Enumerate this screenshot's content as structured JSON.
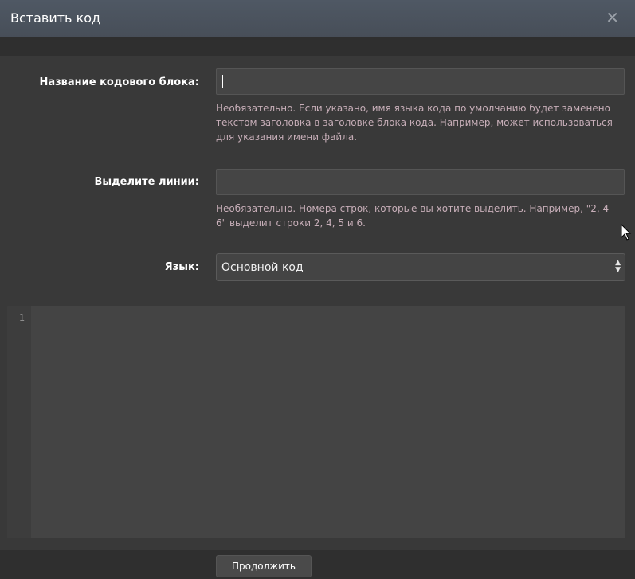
{
  "dialog": {
    "title": "Вставить код",
    "close_glyph": "✕"
  },
  "fields": {
    "block_name": {
      "label": "Название кодового блока:",
      "value": "",
      "hint": "Необязательно. Если указано, имя языка кода по умолчанию будет заменено текстом заголовка в заголовке блока кода. Например, может использоваться для указания имени файла."
    },
    "highlight_lines": {
      "label": "Выделите линии:",
      "value": "",
      "hint": "Необязательно. Номера строк, которые вы хотите выделить. Например, \"2, 4-6\" выделит строки 2, 4, 5 и 6."
    },
    "language": {
      "label": "Язык:",
      "selected": "Основной код"
    }
  },
  "editor": {
    "line_numbers": [
      "1"
    ]
  },
  "footer": {
    "continue_label": "Продолжить"
  },
  "icons": {
    "close": "close-icon",
    "select_arrows": "sort-arrows-icon",
    "pointer": "mouse-pointer-icon"
  }
}
